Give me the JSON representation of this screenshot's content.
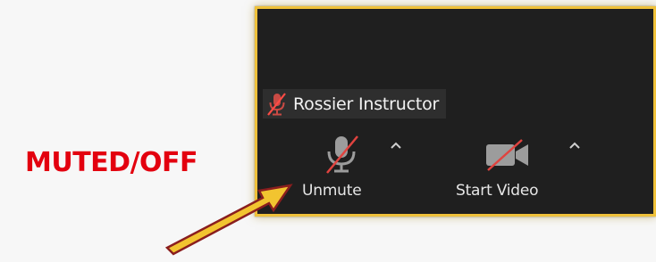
{
  "annotation": {
    "label": "MUTED/OFF",
    "label_color": "#e3000f",
    "arrow_fill": "#f2c430",
    "arrow_stroke": "#8a1e1e",
    "panel_border_color": "#efc13a"
  },
  "participant": {
    "name": "Rossier Instructor",
    "mic_state_icon": "mic-muted-icon"
  },
  "toolbar": {
    "unmute_label": "Unmute",
    "start_video_label": "Start Video",
    "slash_color": "#e0433f",
    "icon_color": "#9c9c9c"
  }
}
